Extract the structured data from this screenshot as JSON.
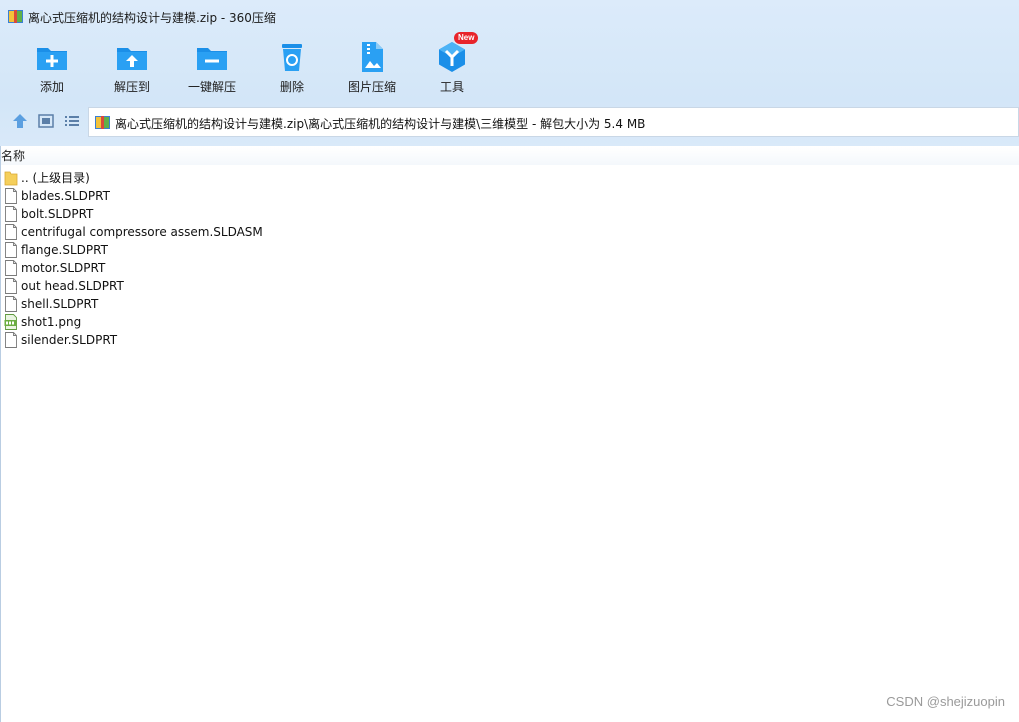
{
  "window": {
    "title": "离心式压缩机的结构设计与建模.zip - 360压缩"
  },
  "toolbar": {
    "items": [
      {
        "label": "添加",
        "icon": "add-folder-icon"
      },
      {
        "label": "解压到",
        "icon": "extract-to-icon"
      },
      {
        "label": "一键解压",
        "icon": "one-click-extract-icon"
      },
      {
        "label": "删除",
        "icon": "trash-icon"
      },
      {
        "label": "图片压缩",
        "icon": "image-compress-icon"
      },
      {
        "label": "工具",
        "icon": "tools-icon"
      }
    ],
    "new_badge": "New"
  },
  "navbar": {
    "path": "离心式压缩机的结构设计与建模.zip\\离心式压缩机的结构设计与建模\\三维模型 - 解包大小为 5.4 MB"
  },
  "list": {
    "column_name": "名称",
    "files": [
      {
        "name": ".. (上级目录)",
        "type": "folder"
      },
      {
        "name": "blades.SLDPRT",
        "type": "file"
      },
      {
        "name": "bolt.SLDPRT",
        "type": "file"
      },
      {
        "name": "centrifugal compressore assem.SLDASM",
        "type": "file"
      },
      {
        "name": "flange.SLDPRT",
        "type": "file"
      },
      {
        "name": "motor.SLDPRT",
        "type": "file"
      },
      {
        "name": "out head.SLDPRT",
        "type": "file"
      },
      {
        "name": "shell.SLDPRT",
        "type": "file"
      },
      {
        "name": "shot1.png",
        "type": "image"
      },
      {
        "name": "silender.SLDPRT",
        "type": "file"
      }
    ]
  },
  "watermark": "CSDN @shejizuopin",
  "colors": {
    "chrome": "#d3e6f8",
    "icon_blue": "#1b8fe8",
    "badge_red": "#e8242b",
    "folder_yellow": "#f5cf5b"
  }
}
